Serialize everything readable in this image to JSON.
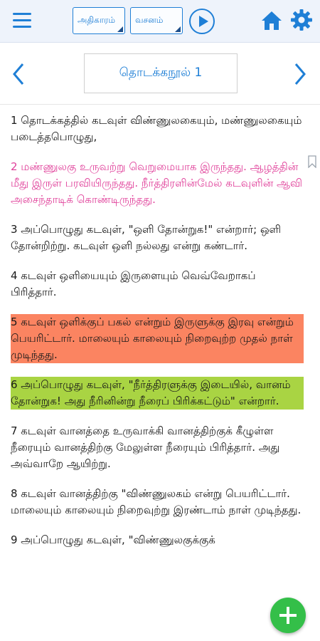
{
  "toolbar": {
    "book_select": "அதிகாரம்",
    "verse_select": "வசனம்",
    "icons": {
      "menu": "menu-icon",
      "play": "play-icon",
      "home": "home-icon",
      "settings": "gear-icon"
    },
    "accent_color": "#1f7fd6"
  },
  "chapter_nav": {
    "title": "தொடக்கநூல் 1",
    "prev_icon": "chevron-left-icon",
    "next_icon": "chevron-right-icon"
  },
  "verses": [
    {
      "text": "1 தொடக்கத்தில் கடவுள் விண்ணுலகையும், மண்ணுலகையும் படைத்தபொழுது,"
    },
    {
      "text": "2 மண்ணுலகு உருவற்று வெறுமையாக இருந்தது. ஆழத்தின் மீது இருள் பரவியிருந்தது. நீர்த்திரளின்மேல் கடவுளின் ஆவி அசைந்தாடிக் கொண்டிருந்தது.",
      "color": "#e0409a"
    },
    {
      "text": "3 அப்பொழுது கடவுள், \"ஒளி தோன்றுக!\" என்றார்; ஒளி தோன்றிற்று. கடவுள் ஒளி நல்லது என்று கண்டார்."
    },
    {
      "text": "4 கடவுள் ஒளியையும் இருளையும் வெவ்வேறாகப் பிரித்தார்."
    },
    {
      "text": "5 கடவுள் ஒளிக்குப் பகல் என்றும் இருளுக்கு இரவு என்றும் பெயரிட்டார். மாலையும் காலையும் நிறைவுற்ற முதல் நாள் முடிந்தது.",
      "highlight": "#fb8461"
    },
    {
      "text": "6 அப்பொழுது கடவுள், \"நீர்த்திரளுக்கு இடையில், வானம் தோன்றுக! அது நீரினின்று நீரைப் பிரிக்கட்டும்\" என்றார்.",
      "highlight": "#a9d443"
    },
    {
      "text": "7 கடவுள் வானத்தை உருவாக்கி வானத்திற்குக் கீழுள்ள நீரையும் வானத்திற்கு மேலுள்ள நீரையும் பிரித்தார். அது அவ்வாறே ஆயிற்று."
    },
    {
      "text": "8 கடவுள் வானத்திற்கு \"விண்ணுலகம் என்று பெயரிட்டார். மாலையும் காலையும் நிறைவுற்று இரண்டாம் நாள் முடிந்தது."
    },
    {
      "text": "9 அப்பொழுது கடவுள், \"விண்ணுலகுக்குக்"
    }
  ],
  "bookmark_icon": "bookmark-icon",
  "fab_icon": "plus-icon"
}
